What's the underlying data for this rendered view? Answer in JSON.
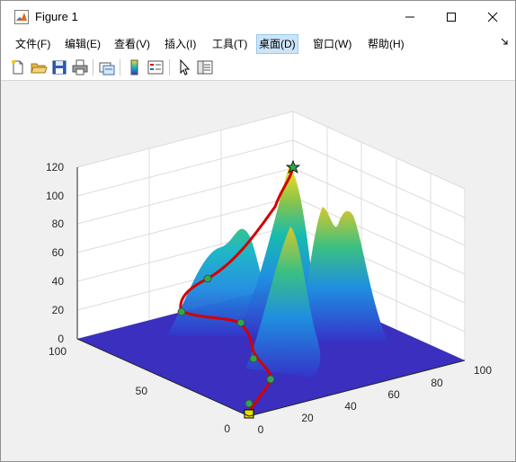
{
  "window": {
    "title": "Figure 1",
    "icon": "matlab-icon",
    "controls": [
      "minimize-icon",
      "maximize-icon",
      "close-icon"
    ]
  },
  "menubar": {
    "items": [
      {
        "label": "文件(F)"
      },
      {
        "label": "编辑(E)"
      },
      {
        "label": "查看(V)"
      },
      {
        "label": "插入(I)"
      },
      {
        "label": "工具(T)"
      },
      {
        "label": "桌面(D)"
      },
      {
        "label": "窗口(W)"
      },
      {
        "label": "帮助(H)"
      }
    ],
    "active_item": "桌面(D)",
    "overflow_icon": "dock-arrow-icon"
  },
  "toolbar": {
    "buttons": [
      "new-figure-icon",
      "open-file-icon",
      "save-icon",
      "print-icon",
      "link-figure-icon",
      "colorbar-icon",
      "legend-icon",
      "pointer-icon",
      "property-inspector-icon"
    ]
  },
  "chart_data": {
    "type": "surface",
    "title": "",
    "xlabel": "",
    "ylabel": "",
    "zlabel": "",
    "x_ticks": [
      "0",
      "20",
      "40",
      "60",
      "80",
      "100"
    ],
    "y_ticks": [
      "0",
      "50",
      "100"
    ],
    "z_ticks": [
      "0",
      "20",
      "40",
      "60",
      "80",
      "100",
      "120"
    ],
    "xlim": [
      0,
      100
    ],
    "ylim": [
      0,
      100
    ],
    "zlim": [
      0,
      120
    ],
    "grid": true,
    "colormap": "parula",
    "surface_peaks": [
      {
        "x": 50,
        "y": 55,
        "height": 120
      },
      {
        "x": 35,
        "y": 75,
        "height": 76
      },
      {
        "x": 40,
        "y": 20,
        "height": 95
      },
      {
        "x": 75,
        "y": 60,
        "height": 90
      },
      {
        "x": 85,
        "y": 55,
        "height": 85
      }
    ],
    "path": {
      "color": "#d40000",
      "start": {
        "x": 0,
        "y": 0,
        "z": 0,
        "marker": "square"
      },
      "end": {
        "x": 50,
        "y": 55,
        "z": 120,
        "marker": "star"
      },
      "waypoints": [
        {
          "x": 0,
          "y": 10,
          "z": 0
        },
        {
          "x": 5,
          "y": 40,
          "z": 0
        },
        {
          "x": 15,
          "y": 60,
          "z": 0
        },
        {
          "x": 25,
          "y": 70,
          "z": 5
        },
        {
          "x": 10,
          "y": 85,
          "z": 15
        },
        {
          "x": 20,
          "y": 90,
          "z": 40
        }
      ]
    }
  }
}
